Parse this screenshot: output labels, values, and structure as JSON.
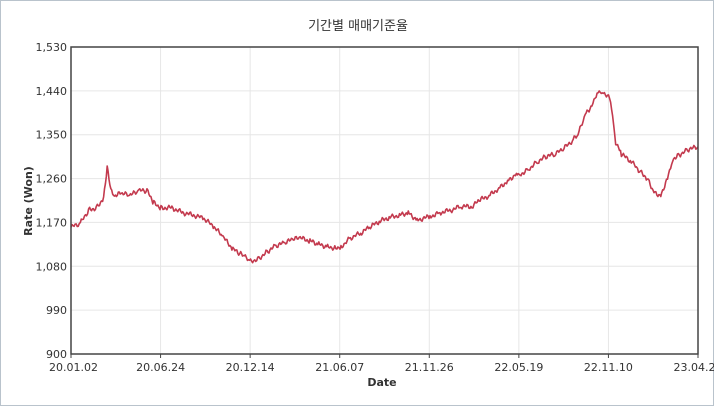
{
  "chart_data": {
    "type": "line",
    "title": "기간별 매매기준율",
    "xlabel": "Date",
    "ylabel": "Rate (Won)",
    "ylim": [
      900,
      1530
    ],
    "yticks": [
      "900",
      "990",
      "1,080",
      "1,170",
      "1,260",
      "1,350",
      "1,440",
      "1,530"
    ],
    "xticks": [
      "20.01.02",
      "20.06.24",
      "20.12.14",
      "21.06.07",
      "21.11.26",
      "22.05.19",
      "22.11.10",
      "23.04.28"
    ],
    "grid": true,
    "color": "#c33a4e",
    "series": [
      {
        "x": [
          "2020-01-02",
          "2020-01-20",
          "2020-02-05",
          "2020-02-20",
          "2020-03-05",
          "2020-03-12",
          "2020-03-19",
          "2020-03-26",
          "2020-04-08",
          "2020-04-24",
          "2020-05-12",
          "2020-05-28",
          "2020-06-10",
          "2020-06-24",
          "2020-07-15",
          "2020-08-05",
          "2020-08-26",
          "2020-09-15",
          "2020-10-05",
          "2020-10-22",
          "2020-11-10",
          "2020-11-25",
          "2020-12-04",
          "2020-12-14",
          "2020-12-30",
          "2021-01-15",
          "2021-02-01",
          "2021-02-18",
          "2021-03-05",
          "2021-03-20",
          "2021-04-08",
          "2021-04-25",
          "2021-05-12",
          "2021-05-26",
          "2021-06-07",
          "2021-06-25",
          "2021-07-15",
          "2021-08-01",
          "2021-08-20",
          "2021-09-08",
          "2021-09-28",
          "2021-10-15",
          "2021-11-01",
          "2021-11-26",
          "2021-12-15",
          "2022-01-05",
          "2022-01-25",
          "2022-02-15",
          "2022-03-01",
          "2022-03-20",
          "2022-04-08",
          "2022-04-25",
          "2022-05-12",
          "2022-05-19",
          "2022-06-05",
          "2022-06-22",
          "2022-07-08",
          "2022-07-25",
          "2022-08-10",
          "2022-08-28",
          "2022-09-08",
          "2022-09-22",
          "2022-10-05",
          "2022-10-15",
          "2022-10-25",
          "2022-11-10",
          "2022-11-20",
          "2022-12-01",
          "2022-12-20",
          "2023-01-05",
          "2023-01-20",
          "2023-02-02",
          "2023-02-15",
          "2023-02-28",
          "2023-03-10",
          "2023-03-25",
          "2023-04-10",
          "2023-04-28"
        ],
        "y": [
          1160,
          1168,
          1195,
          1200,
          1220,
          1285,
          1240,
          1225,
          1230,
          1225,
          1235,
          1235,
          1210,
          1200,
          1200,
          1190,
          1185,
          1178,
          1160,
          1140,
          1115,
          1105,
          1098,
          1090,
          1096,
          1110,
          1122,
          1128,
          1135,
          1138,
          1132,
          1125,
          1120,
          1118,
          1120,
          1138,
          1148,
          1160,
          1172,
          1180,
          1185,
          1190,
          1175,
          1182,
          1190,
          1195,
          1203,
          1202,
          1215,
          1225,
          1240,
          1255,
          1270,
          1268,
          1280,
          1295,
          1305,
          1310,
          1320,
          1338,
          1350,
          1392,
          1410,
          1438,
          1440,
          1422,
          1335,
          1310,
          1295,
          1275,
          1260,
          1232,
          1225,
          1262,
          1300,
          1310,
          1320,
          1325
        ]
      }
    ]
  }
}
